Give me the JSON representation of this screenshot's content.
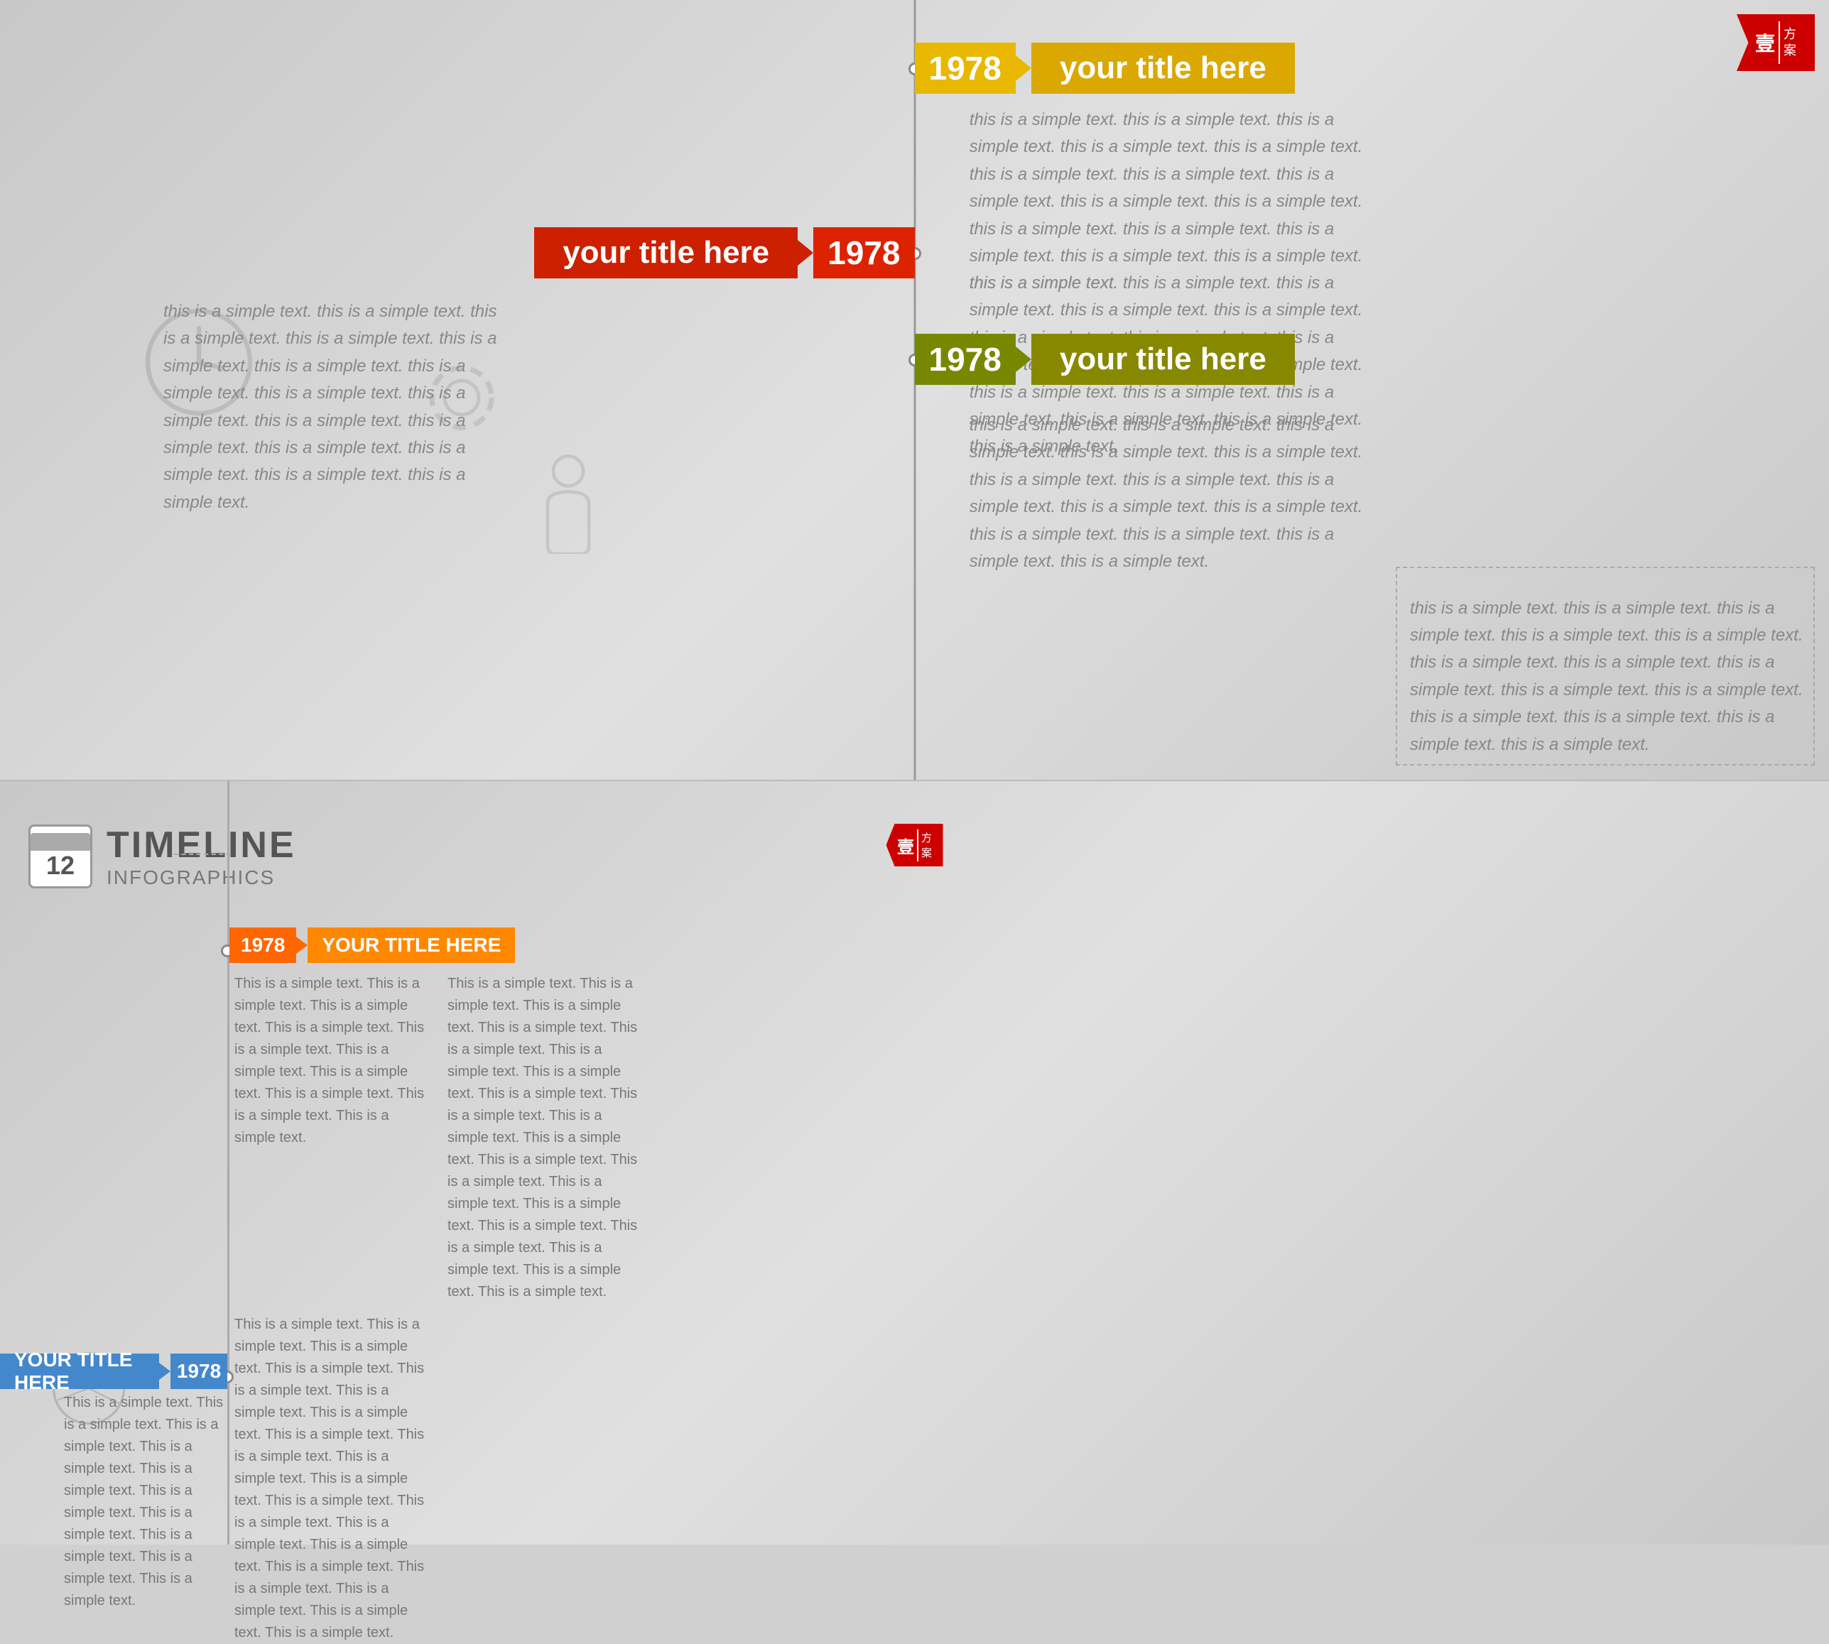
{
  "top": {
    "corner_badge": {
      "char": "壹",
      "line1": "方",
      "line2": "案"
    },
    "item1": {
      "year": "1978",
      "title": "your title here",
      "year_color": "#e8b800",
      "title_color": "#daa800"
    },
    "item2": {
      "year": "1978",
      "title": "your title here",
      "year_color": "#dd2200",
      "title_color": "#cc2000"
    },
    "item3": {
      "year": "1978",
      "title": "your title here",
      "year_color": "#888800",
      "title_color": "#778800"
    },
    "body_text": "this is a simple text. this is a simple text. this is a simple text. this is a simple text. this is a simple text. this is a simple text. this is a simple text. this is a simple text. this is a simple text. this is a simple text. this is a simple text. this is a simple text. this is a simple text. this is a simple text. this is a simple text. this is a simple text.",
    "body_text2": "this is a simple text. this is a simple text. this is a simple text. this is a simple text. this is a simple text. this is a simple text. this is a simple text. this is a simple text. this is a simple text. this is a simple text. this is a simple text. this is a simple text. this is a simple text. this is a simple text. this is a simple text.",
    "body_text3": "this is a simple text. this is a simple text. this is a simple text. this is a simple text. this is a simple text. this is a simple text. this is a simple text. this is a simple text. this is a simple text. this is a simple text. this is a simple text. this is a simple text. this is a simple text. this is a simple text."
  },
  "bottom": {
    "logo": {
      "calendar_num": "12",
      "title_big": "TIMELINE",
      "subtitle": "INFOGRAPHICS"
    },
    "corner_badge": {
      "char": "壹",
      "line1": "方",
      "line2": "案"
    },
    "item1": {
      "year": "1978",
      "title": "YOUR TITLE HERE",
      "year_color": "#ff6600",
      "title_color": "#ff8800"
    },
    "item2": {
      "year": "1978",
      "title": "YOUR TITLE HERE",
      "year_color": "#4488cc",
      "title_color": "#4488cc"
    },
    "body_text1": "This is a simple text. This is a simple text. This is a simple text. This is a simple text. This is a simple text. This is a simple text. This is a simple text. This is a simple text. This is a simple text. This is a simple text.",
    "body_text2": "This is a simple text. This is a simple text. This is a simple text. This is a simple text. This is a simple text. This is a simple text. This is a simple text. This is a simple text. This is a simple text. This is a simple text. This is a simple text. This is a simple text. This is a simple text. This is a simple text. This is a simple text. This is a simple text. This is a simple text. This is a simple text. This is a simple text. This is a simple text.",
    "body_text3": "This is a simple text. This is a simple text. This is a simple text. This is a simple text. This is a simple text. This is a simple text. This is a simple text. This is a simple text. This is a simple text. This is a simple text."
  }
}
